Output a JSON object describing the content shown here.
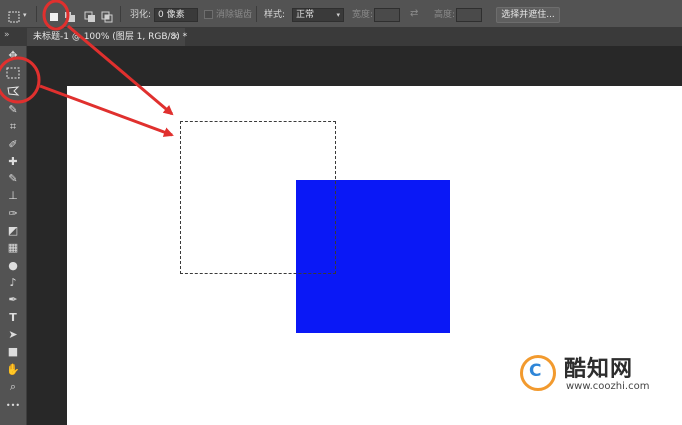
{
  "options_bar": {
    "feather_label": "羽化:",
    "feather_value": "0 像素",
    "antialias_label": "消除锯齿",
    "style_label": "样式:",
    "style_value": "正常",
    "width_label": "宽度:",
    "height_label": "高度:",
    "select_mask_button": "选择并遮住..."
  },
  "document_tab": {
    "title": "未标题-1 @ 100% (图层 1, RGB/8) *",
    "close_glyph": "×"
  },
  "tools": [
    {
      "name": "move-tool-icon",
      "glyph": "✥"
    },
    {
      "name": "rectangular-marquee-tool-icon",
      "glyph": ""
    },
    {
      "name": "lasso-tool-icon",
      "glyph": ""
    },
    {
      "name": "quick-selection-tool-icon",
      "glyph": "✎"
    },
    {
      "name": "crop-tool-icon",
      "glyph": "⌗"
    },
    {
      "name": "eyedropper-tool-icon",
      "glyph": "✐"
    },
    {
      "name": "healing-brush-tool-icon",
      "glyph": "✚"
    },
    {
      "name": "brush-tool-icon",
      "glyph": "✎"
    },
    {
      "name": "clone-stamp-tool-icon",
      "glyph": "⊥"
    },
    {
      "name": "history-brush-tool-icon",
      "glyph": "✑"
    },
    {
      "name": "eraser-tool-icon",
      "glyph": "◩"
    },
    {
      "name": "gradient-tool-icon",
      "glyph": "▦"
    },
    {
      "name": "blur-tool-icon",
      "glyph": "●"
    },
    {
      "name": "dodge-tool-icon",
      "glyph": "♪"
    },
    {
      "name": "pen-tool-icon",
      "glyph": "✒"
    },
    {
      "name": "type-tool-icon",
      "glyph": "T"
    },
    {
      "name": "path-selection-tool-icon",
      "glyph": "➤"
    },
    {
      "name": "rectangle-tool-icon",
      "glyph": "■"
    },
    {
      "name": "hand-tool-icon",
      "glyph": "✋"
    },
    {
      "name": "zoom-tool-icon",
      "glyph": "⌕"
    },
    {
      "name": "more-tools-icon",
      "glyph": "•••"
    }
  ],
  "colors": {
    "ui_dark": "#535353",
    "canvas_bg": "#282828",
    "shape_fill": "#0a18f6",
    "annotation_red": "#e0302e",
    "watermark_orange": "#f29a2e",
    "watermark_blue": "#2f86d8"
  },
  "watermark": {
    "logo_letter": "C",
    "name": "酷知网",
    "url": "www.coozhi.com"
  }
}
